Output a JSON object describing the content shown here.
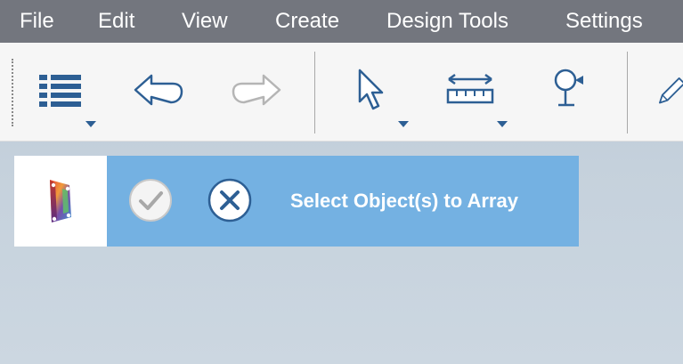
{
  "menu": {
    "items": [
      "File",
      "Edit",
      "View",
      "Create",
      "Design Tools",
      "Settings"
    ]
  },
  "toolbar": {
    "tools": [
      {
        "icon": "list-icon",
        "has_dropdown": true
      },
      {
        "icon": "undo-icon",
        "has_dropdown": false
      },
      {
        "icon": "redo-icon",
        "has_dropdown": false,
        "disabled": true
      },
      {
        "icon": "select-pointer-icon",
        "has_dropdown": true
      },
      {
        "icon": "measure-icon",
        "has_dropdown": true
      },
      {
        "icon": "pin-icon",
        "has_dropdown": false
      },
      {
        "icon": "pencil-icon",
        "has_dropdown": false
      }
    ]
  },
  "command_panel": {
    "prompt": "Select Object(s) to Array",
    "logo_icon": "app-logo-icon",
    "confirm_icon": "checkmark-icon",
    "cancel_icon": "close-icon"
  },
  "colors": {
    "menubar_bg": "#73767e",
    "toolbar_bg": "#f6f6f6",
    "icon_blue": "#2d5f94",
    "panel_blue": "#74b1e2",
    "disabled_icon": "#b5b5b5"
  }
}
